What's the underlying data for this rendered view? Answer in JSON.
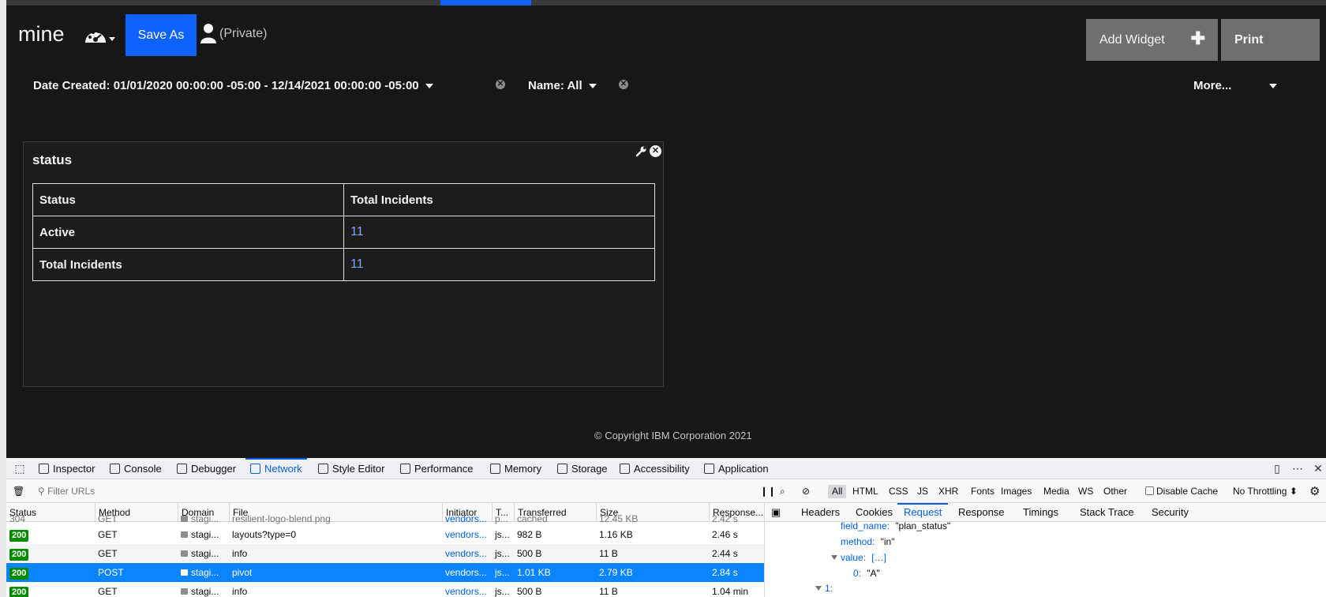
{
  "header": {
    "dashboard_title": "mine",
    "save_as_label": "Save As",
    "privacy_label": "(Private)",
    "add_widget_label": "Add Widget",
    "add_widget_plus": "✚",
    "print_label": "Print"
  },
  "filters": {
    "date_created": "Date Created: 01/01/2020 00:00:00 -05:00 - 12/14/2021 00:00:00 -05:00",
    "name": "Name: All",
    "more": "More...",
    "clear_glyph": "✕"
  },
  "widget": {
    "title": "status",
    "close_glyph": "✕",
    "table": {
      "headers": [
        "Status",
        "Total Incidents"
      ],
      "rows": [
        {
          "label": "Active",
          "value": "11"
        },
        {
          "label": "Total Incidents",
          "value": "11"
        }
      ]
    }
  },
  "footer": {
    "copyright": "© Copyright IBM Corporation 2021"
  },
  "devtools": {
    "tabs": [
      "Inspector",
      "Console",
      "Debugger",
      "Network",
      "Style Editor",
      "Performance",
      "Memory",
      "Storage",
      "Accessibility",
      "Application"
    ],
    "active_tab": "Network",
    "filter_placeholder": "Filter URLs",
    "type_filters": [
      "All",
      "HTML",
      "CSS",
      "JS",
      "XHR",
      "Fonts",
      "Images",
      "Media",
      "WS",
      "Other"
    ],
    "disable_cache_label": "Disable Cache",
    "throttling_label": "No Throttling ⬍",
    "columns": [
      "Status",
      "Method",
      "Domain",
      "File",
      "Initiator",
      "T...",
      "Transferred",
      "Size",
      "Response..."
    ],
    "requests": [
      {
        "status": "304",
        "method": "GET",
        "domain": "stagi...",
        "file": "resilient-logo-blend.png",
        "initiator": "vendors...",
        "type": "p...",
        "transferred": "cached",
        "size": "12.45 KB",
        "response": "2.42 s"
      },
      {
        "status": "200",
        "method": "GET",
        "domain": "stagi...",
        "file": "layouts?type=0",
        "initiator": "vendors...",
        "type": "js...",
        "transferred": "982 B",
        "size": "1.16 KB",
        "response": "2.46 s"
      },
      {
        "status": "200",
        "method": "GET",
        "domain": "stagi...",
        "file": "info",
        "initiator": "vendors...",
        "type": "js...",
        "transferred": "500 B",
        "size": "11 B",
        "response": "2.44 s"
      },
      {
        "status": "200",
        "method": "POST",
        "domain": "stagi...",
        "file": "pivot",
        "initiator": "vendors...",
        "type": "js...",
        "transferred": "1.01 KB",
        "size": "2.79 KB",
        "response": "2.84 s"
      },
      {
        "status": "200",
        "method": "GET",
        "domain": "stagi...",
        "file": "info",
        "initiator": "vendors...",
        "type": "js...",
        "transferred": "500 B",
        "size": "11 B",
        "response": "1.04 min"
      }
    ],
    "detail_tabs": [
      "Headers",
      "Cookies",
      "Request",
      "Response",
      "Timings",
      "Stack Trace",
      "Security"
    ],
    "active_detail_tab": "Request",
    "request_body": {
      "field_name_key": "field_name:",
      "field_name_val": "\"plan_status\"",
      "method_key": "method:",
      "method_val": "\"in\"",
      "value_key": "value:",
      "value_val": "[…]",
      "item0_key": "0:",
      "item0_val": "\"A\"",
      "item1_key": "1:"
    }
  }
}
